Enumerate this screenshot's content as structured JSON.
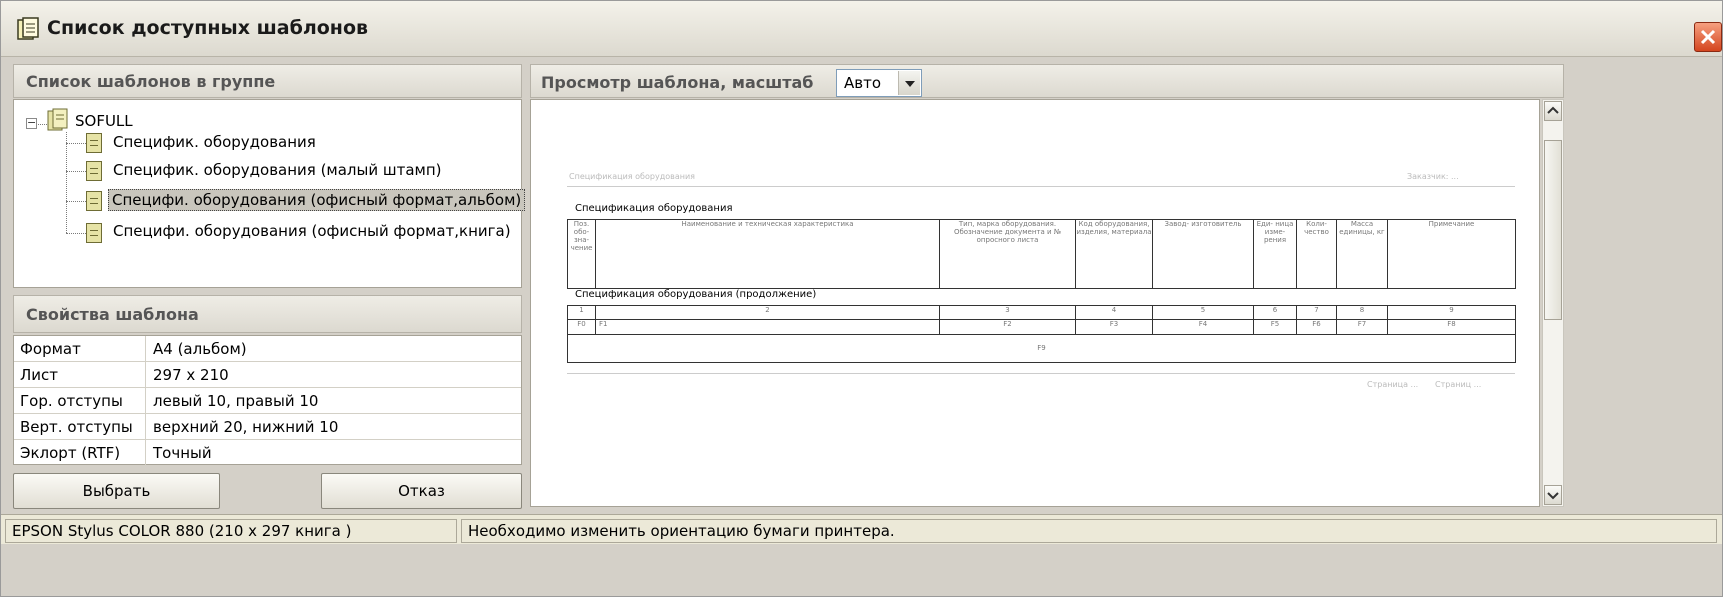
{
  "window": {
    "title": "Список доступных шаблонов"
  },
  "left": {
    "tree_header": "Список шаблонов в группе",
    "tree": {
      "group": "SOFULL",
      "items": [
        {
          "label": "Специфик. оборудования",
          "selected": false
        },
        {
          "label": "Специфик. оборудования (малый штамп)",
          "selected": false
        },
        {
          "label": "Специфи. оборудования (офисный формат,альбом)",
          "selected": true
        },
        {
          "label": "Специфи. оборудования (офисный формат,книга)",
          "selected": false
        }
      ]
    },
    "props_header": "Свойства шаблона",
    "props": [
      {
        "name": "Формат",
        "value": "A4 (альбом)"
      },
      {
        "name": "Лист",
        "value": "297 x 210"
      },
      {
        "name": "Гор. отступы",
        "value": "левый 10,  правый 10"
      },
      {
        "name": "Верт. отступы",
        "value": "верхний 20,  нижний 10"
      },
      {
        "name": "Эклорт (RTF)",
        "value": "Точный"
      }
    ],
    "buttons": {
      "select": "Выбрать",
      "cancel": "Отказ"
    }
  },
  "right": {
    "header": "Просмотр шаблона,    масштаб",
    "zoom": "Авто",
    "page": {
      "header_left": "Спецификация оборудования",
      "header_right": "Заказчик: ...",
      "title1": "Спецификация оборудования",
      "title2": "Спецификация оборудования (продолжение)",
      "columns": [
        "Поз. обо- зна- чение",
        "Наименование и техническая характеристика",
        "Тип, марка оборудования. Обозначение документа и № опросного листа",
        "Код оборудования, изделия, материала",
        "Завод- изготовитель",
        "Еди- ница изме- рения",
        "Коли- чество",
        "Масса единицы, кг",
        "Примечание"
      ],
      "numbers": [
        "1",
        "2",
        "3",
        "4",
        "5",
        "6",
        "7",
        "8",
        "9"
      ],
      "fields": [
        "F0",
        "F1",
        "F2",
        "F3",
        "F4",
        "F5",
        "F6",
        "F7",
        "F8"
      ],
      "footer_field": "F9",
      "footer_right1": "Страница ...",
      "footer_right2": "Страниц ..."
    }
  },
  "status": {
    "printer": "EPSON Stylus COLOR 880 (210 x 297 книга )",
    "message": "Необходимо изменить ориентацию бумаги принтера."
  }
}
